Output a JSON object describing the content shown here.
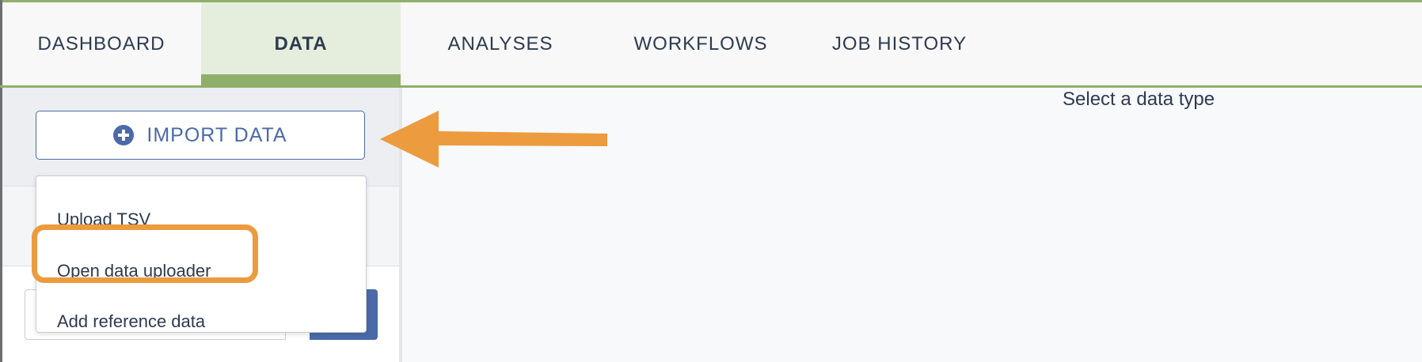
{
  "nav": {
    "tabs": [
      {
        "label": "DASHBOARD",
        "active": false
      },
      {
        "label": "DATA",
        "active": true
      },
      {
        "label": "ANALYSES",
        "active": false
      },
      {
        "label": "WORKFLOWS",
        "active": false
      },
      {
        "label": "JOB HISTORY",
        "active": false
      }
    ]
  },
  "sidebar": {
    "import_button": {
      "label": "IMPORT DATA",
      "icon": "plus-circle-icon"
    },
    "dropdown": {
      "items": [
        {
          "label": "Upload TSV"
        },
        {
          "label": "Open data uploader",
          "highlighted": true
        },
        {
          "label": "Add reference data"
        }
      ]
    }
  },
  "main": {
    "hint": "Select a data type"
  },
  "colors": {
    "accent_green": "#8fb06a",
    "primary_blue": "#4a6aa8",
    "annotation_orange": "#ec9b3e",
    "text": "#2e3b4e"
  },
  "annotations": {
    "arrow_icon": "left-arrow-icon",
    "highlight": "Open data uploader"
  }
}
